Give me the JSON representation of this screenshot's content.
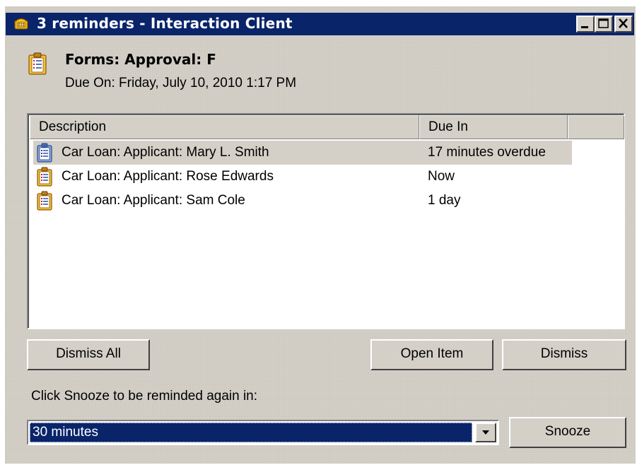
{
  "window": {
    "title": "3 reminders - Interaction Client",
    "controls": {
      "minimize": "_",
      "maximize": "□",
      "close": "X"
    },
    "titlebar_color": "#0a246a"
  },
  "reminder_header": {
    "title": "Forms: Approval: F",
    "due_on": "Due On: Friday, July 10, 2010 1:17 PM",
    "icon": "form-clipboard-icon"
  },
  "list": {
    "columns": {
      "description": "Description",
      "due_in": "Due In"
    },
    "rows": [
      {
        "description": "Car Loan: Applicant: Mary L. Smith",
        "due_in": "17 minutes overdue",
        "selected": true,
        "icon": "form-clipboard-icon"
      },
      {
        "description": "Car Loan: Applicant: Rose Edwards",
        "due_in": "Now",
        "selected": false,
        "icon": "form-clipboard-icon"
      },
      {
        "description": "Car Loan: Applicant: Sam Cole",
        "due_in": "1 day",
        "selected": false,
        "icon": "form-clipboard-icon"
      }
    ]
  },
  "buttons": {
    "dismiss_all": "Dismiss All",
    "open_item": "Open Item",
    "dismiss": "Dismiss",
    "snooze": "Snooze"
  },
  "snooze": {
    "label": "Click Snooze to be reminded again in:",
    "selected_value": "30 minutes"
  }
}
